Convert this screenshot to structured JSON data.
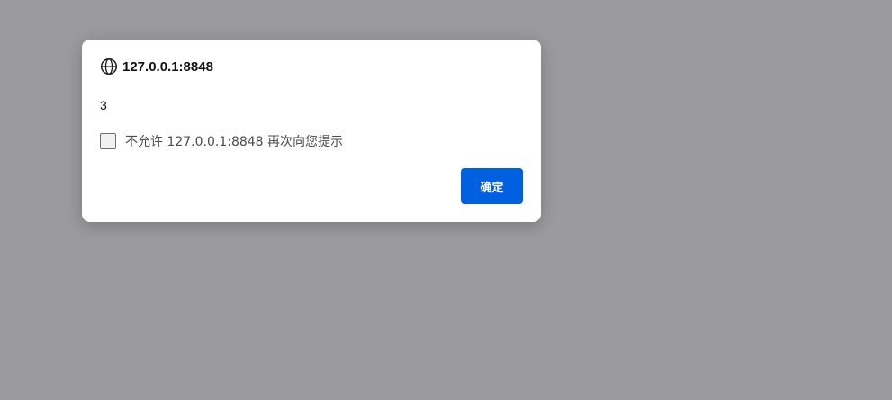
{
  "dialog": {
    "origin": "127.0.0.1:8848",
    "message": "3",
    "checkbox_label": "不允许 127.0.0.1:8848 再次向您提示",
    "checkbox_checked": false,
    "ok_label": "确定",
    "icon": "globe-icon"
  },
  "colors": {
    "backdrop": "#9b9b9d",
    "dialog_bg": "#ffffff",
    "primary_button": "#0060df",
    "primary_button_text": "#ffffff"
  }
}
